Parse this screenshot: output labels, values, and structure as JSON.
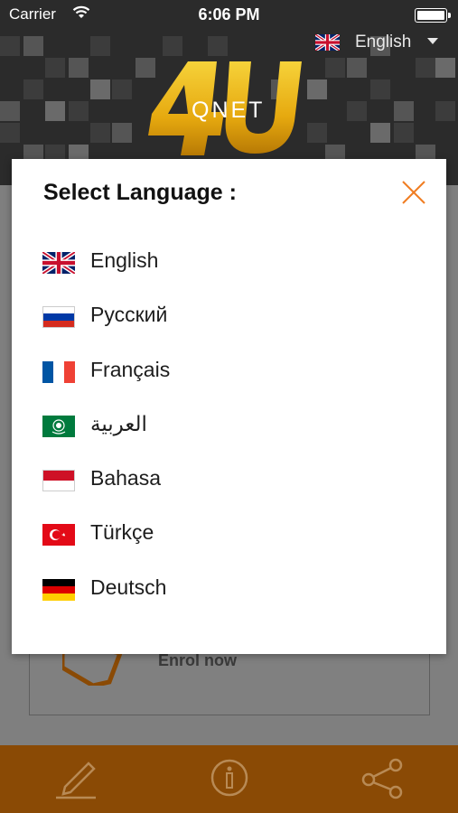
{
  "status_bar": {
    "carrier": "Carrier",
    "time": "6:06 PM"
  },
  "header": {
    "current_language": "English",
    "logo_brand": "QNET",
    "logo_number": "4U"
  },
  "modal": {
    "title": "Select Language :",
    "languages": [
      {
        "label": "English",
        "flag": "uk-flag"
      },
      {
        "label": "Русский",
        "flag": "russia-flag"
      },
      {
        "label": "Français",
        "flag": "france-flag"
      },
      {
        "label": "العربية",
        "flag": "arab-league-flag"
      },
      {
        "label": "Bahasa",
        "flag": "indonesia-flag"
      },
      {
        "label": "Türkçe",
        "flag": "turkey-flag"
      },
      {
        "label": "Deutsch",
        "flag": "germany-flag"
      }
    ]
  },
  "background": {
    "enrol_label": "Enrol now"
  },
  "tabbar": {
    "icons": [
      "pencil-icon",
      "info-icon",
      "share-icon"
    ]
  },
  "colors": {
    "accent": "#f07d22",
    "tabbar": "#8a4a05",
    "overlay": "#808080"
  }
}
